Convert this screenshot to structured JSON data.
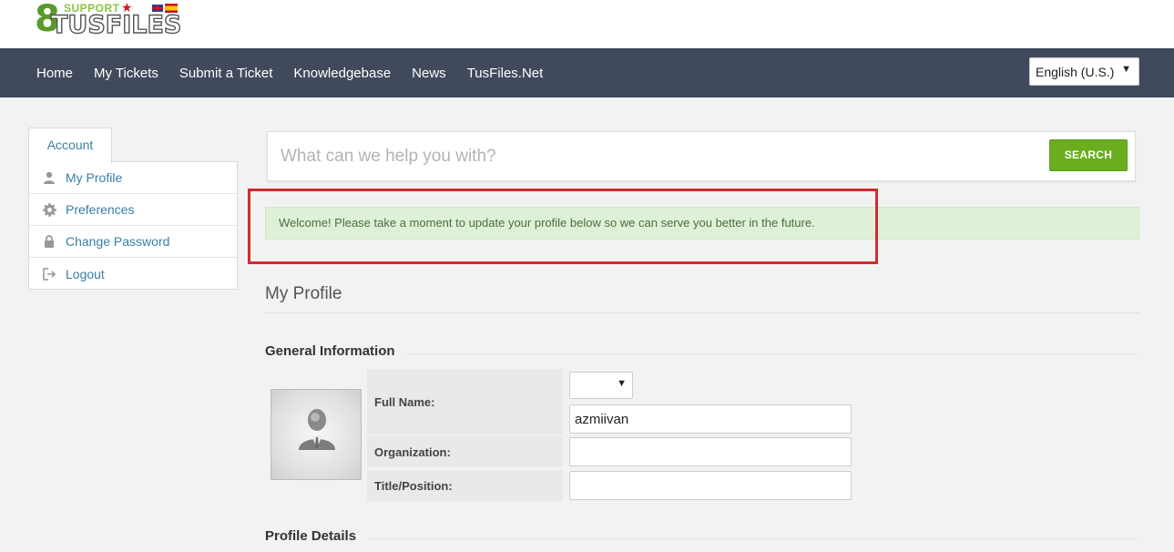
{
  "header": {
    "logo": {
      "support": "SUPPORT",
      "name": "TUSFILES",
      "digit": "8"
    },
    "nav": [
      {
        "label": "Home"
      },
      {
        "label": "My Tickets"
      },
      {
        "label": "Submit a Ticket"
      },
      {
        "label": "Knowledgebase"
      },
      {
        "label": "News"
      },
      {
        "label": "TusFiles.Net"
      }
    ],
    "language": "English (U.S.)"
  },
  "sidebar": {
    "tab": "Account",
    "items": [
      {
        "label": "My Profile",
        "icon": "user-icon"
      },
      {
        "label": "Preferences",
        "icon": "gear-icon"
      },
      {
        "label": "Change Password",
        "icon": "lock-icon"
      },
      {
        "label": "Logout",
        "icon": "logout-icon"
      }
    ]
  },
  "search": {
    "placeholder": "What can we help you with?",
    "button": "SEARCH"
  },
  "alert": {
    "message": "Welcome! Please take a moment to update your profile below so we can serve you better in the future."
  },
  "profile": {
    "title": "My Profile",
    "general_title": "General Information",
    "details_title": "Profile Details",
    "full_name_label": "Full Name:",
    "full_name_value": "azmiivan",
    "salutation_value": "",
    "organization_label": "Organization:",
    "organization_value": "",
    "title_label": "Title/Position:",
    "title_value": ""
  },
  "colors": {
    "navbar": "#414a5c",
    "accent_green": "#6aae1f",
    "link_blue": "#3a7ea6",
    "alert_bg": "#dff0d8",
    "highlight_red": "#d42a2f"
  }
}
